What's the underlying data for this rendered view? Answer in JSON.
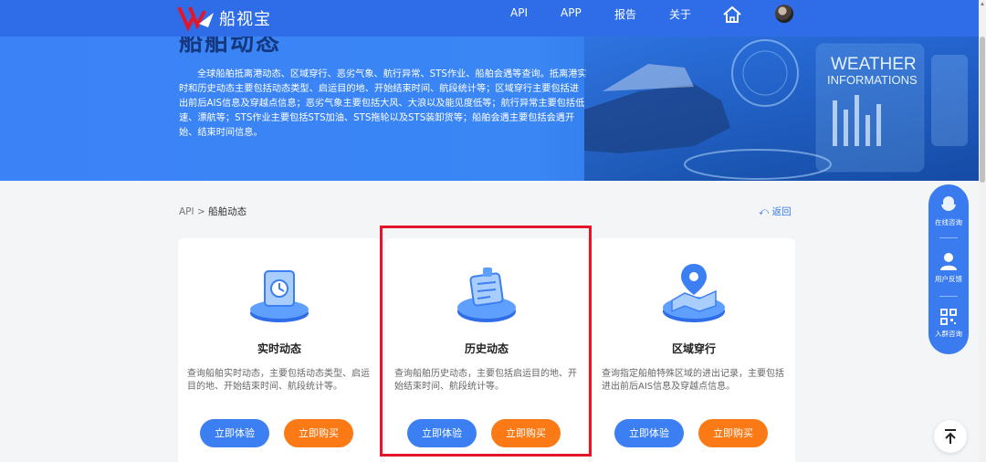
{
  "brand": {
    "name": "船视宝"
  },
  "nav": {
    "items": [
      "API",
      "APP",
      "报告",
      "关于"
    ]
  },
  "hero": {
    "title": "船舶动态",
    "description": "全球船舶抵离港动态、区域穿行、恶劣气象、航行异常、STS作业、船舶会遇等查询。抵离港实时和历史动态主要包括动态类型、启运目的地、开始结束时间、航段统计等；区域穿行主要包括进出前后AIS信息及穿越点信息；恶劣气象主要包括大风、大浪以及能见度低等；航行异常主要包括低速、漂航等；STS作业主要包括STS加油、STS拖轮以及STS装卸货等；船舶会遇主要包括会遇开始、结束时间信息。",
    "art_text": [
      "WEATHER",
      "INFORMATIONS"
    ]
  },
  "breadcrumb": {
    "root": "API",
    "separator": ">",
    "current": "船舶动态",
    "back": "返回"
  },
  "cards": [
    {
      "title": "实时动态",
      "desc": "查询船舶实时动态，主要包括动态类型、启运目的地、开始结束时间、航段统计等。",
      "try": "立即体验",
      "buy": "立即购买",
      "icon": "realtime-status-icon"
    },
    {
      "title": "历史动态",
      "desc": "查询船舶历史动态，主要包括启运目的地、开始结束时间、航段统计等。",
      "try": "立即体验",
      "buy": "立即购买",
      "icon": "history-status-icon"
    },
    {
      "title": "区域穿行",
      "desc": "查询指定船舶特殊区域的进出记录，主要包括进出前后AIS信息及穿越点信息。",
      "try": "立即体验",
      "buy": "立即购买",
      "icon": "region-crossing-icon"
    }
  ],
  "float_panel": {
    "items": [
      "在线咨询",
      "用户反馈",
      "入群咨询"
    ]
  },
  "colors": {
    "primary": "#2f6de8",
    "buy": "#fb7a16",
    "highlight": "#e3152b"
  }
}
